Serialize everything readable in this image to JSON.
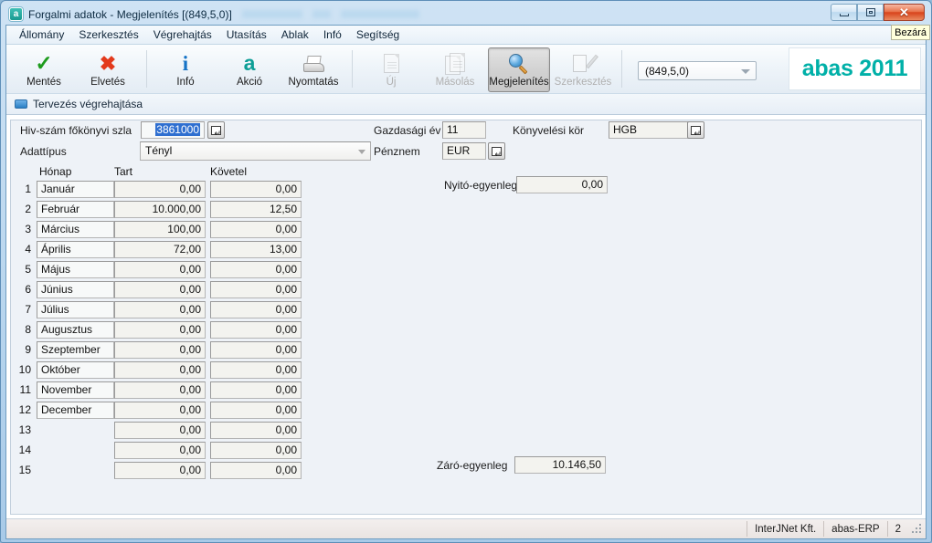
{
  "window": {
    "app_icon": "abas-app-icon",
    "title": "Forgalmi adatok - Megjelenítés  [(849,5,0)]",
    "minimize_label": "Minimalizálás",
    "maximize_label": "Teljes méret",
    "close_label": "Bezárás",
    "tooltip": "Bezárá"
  },
  "menubar": {
    "items": [
      {
        "label": "Állomány"
      },
      {
        "label": "Szerkesztés"
      },
      {
        "label": "Végrehajtás"
      },
      {
        "label": "Utasítás"
      },
      {
        "label": "Ablak"
      },
      {
        "label": "Infó"
      },
      {
        "label": "Segítség"
      }
    ]
  },
  "toolbar": {
    "buttons": [
      {
        "label": "Mentés",
        "icon": "check-icon",
        "state": "enabled"
      },
      {
        "label": "Elvetés",
        "icon": "x-icon",
        "state": "enabled"
      },
      {
        "label": "Infó",
        "icon": "info-icon",
        "state": "enabled"
      },
      {
        "label": "Akció",
        "icon": "action-icon",
        "state": "enabled"
      },
      {
        "label": "Nyomtatás",
        "icon": "printer-icon",
        "state": "enabled"
      },
      {
        "label": "Új",
        "icon": "new-doc-icon",
        "state": "disabled"
      },
      {
        "label": "Másolás",
        "icon": "copy-icon",
        "state": "disabled"
      },
      {
        "label": "Megjelenítés",
        "icon": "magnifier-icon",
        "state": "active"
      },
      {
        "label": "Szerkesztés",
        "icon": "edit-icon",
        "state": "disabled"
      }
    ],
    "record_combo_value": "(849,5,0)",
    "logo": "abas 2011",
    "logo_color": "#00b0a8"
  },
  "substrip": {
    "icon": "blue-box-icon",
    "label": "Tervezés végrehajtása"
  },
  "form": {
    "account_label": "Hiv-szám főkönyvi szla",
    "account_value": "3861000",
    "account_picker": "picker-icon",
    "datatype_label": "Adattípus",
    "datatype_value": "Tényl",
    "fiscal_year_label": "Gazdasági év",
    "fiscal_year_value": "11",
    "currency_label": "Pénznem",
    "currency_value": "EUR",
    "currency_picker": "picker-icon",
    "ledger_label": "Könyvelési kör",
    "ledger_value": "HGB",
    "ledger_picker": "picker-icon",
    "opening_balance_label": "Nyitó-egyenleg",
    "opening_balance_value": "0,00",
    "closing_balance_label": "Záró-egyenleg",
    "closing_balance_value": "10.146,50"
  },
  "table": {
    "columns": [
      "Hónap",
      "Tart",
      "Követel"
    ],
    "rows": [
      {
        "n": "1",
        "month": "Január",
        "debit": "0,00",
        "credit": "0,00"
      },
      {
        "n": "2",
        "month": "Február",
        "debit": "10.000,00",
        "credit": "12,50"
      },
      {
        "n": "3",
        "month": "Március",
        "debit": "100,00",
        "credit": "0,00"
      },
      {
        "n": "4",
        "month": "Április",
        "debit": "72,00",
        "credit": "13,00"
      },
      {
        "n": "5",
        "month": "Május",
        "debit": "0,00",
        "credit": "0,00"
      },
      {
        "n": "6",
        "month": "Június",
        "debit": "0,00",
        "credit": "0,00"
      },
      {
        "n": "7",
        "month": "Július",
        "debit": "0,00",
        "credit": "0,00"
      },
      {
        "n": "8",
        "month": "Augusztus",
        "debit": "0,00",
        "credit": "0,00"
      },
      {
        "n": "9",
        "month": "Szeptember",
        "debit": "0,00",
        "credit": "0,00"
      },
      {
        "n": "10",
        "month": "Október",
        "debit": "0,00",
        "credit": "0,00"
      },
      {
        "n": "11",
        "month": "November",
        "debit": "0,00",
        "credit": "0,00"
      },
      {
        "n": "12",
        "month": "December",
        "debit": "0,00",
        "credit": "0,00"
      },
      {
        "n": "13",
        "month": "",
        "debit": "0,00",
        "credit": "0,00"
      },
      {
        "n": "14",
        "month": "",
        "debit": "0,00",
        "credit": "0,00"
      },
      {
        "n": "15",
        "month": "",
        "debit": "0,00",
        "credit": "0,00"
      }
    ]
  },
  "statusbar": {
    "cells": [
      "InterJNet Kft.",
      "abas-ERP",
      "2"
    ]
  }
}
